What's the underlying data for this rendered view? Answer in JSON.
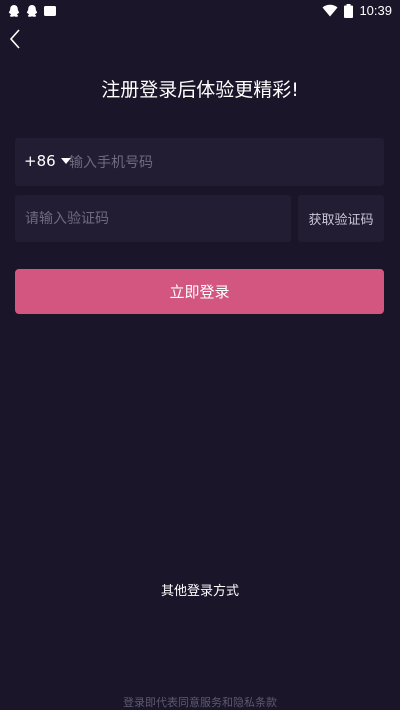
{
  "status_bar": {
    "time": "10:39",
    "left_icons": [
      "qq-icon",
      "qq-icon",
      "message-icon"
    ],
    "right_icons": [
      "wifi-icon",
      "battery-icon"
    ]
  },
  "header": {
    "back_icon": "chevron-left-icon",
    "title": "注册登录后体验更精彩!"
  },
  "form": {
    "country_code": "+86",
    "phone_placeholder": "输入手机号码",
    "code_placeholder": "请输入验证码",
    "get_code_label": "获取验证码",
    "submit_label": "立即登录"
  },
  "other_login_label": "其他登录方式",
  "terms_text": "登录即代表同意服务和隐私条款",
  "colors": {
    "background": "#1a1528",
    "field_background": "#231d34",
    "accent": "#d2567f"
  }
}
